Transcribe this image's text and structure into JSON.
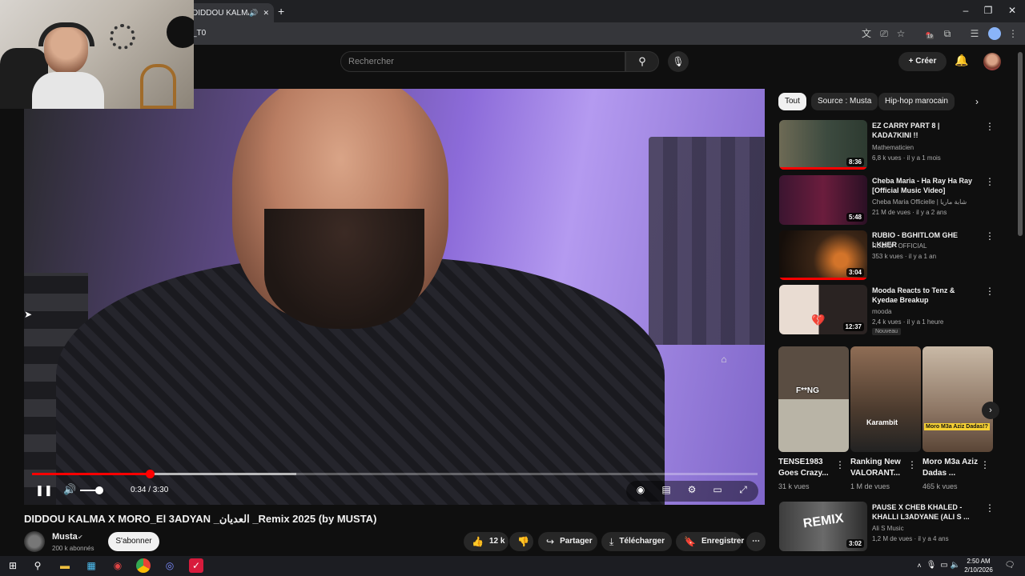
{
  "browser": {
    "tab_title": "DIDDOU KALMA X MORO_El",
    "url_fragment": "_T0",
    "extension_badge": "19"
  },
  "masthead": {
    "search_placeholder": "Rechercher",
    "create_label": "Créer"
  },
  "player": {
    "time": "0:34 / 3:30",
    "progress_fraction": 0.162
  },
  "video": {
    "title": "DIDDOU KALMA X MORO_El 3ADYAN _العديان _Remix 2025 (by MUSTA)",
    "channel": "Musta",
    "subscribers": "200 k abonnés",
    "subscribe_label": "S'abonner",
    "likes": "12 k",
    "share_label": "Partager",
    "download_label": "Télécharger",
    "save_label": "Enregistrer"
  },
  "chips": [
    "Tout",
    "Source : Musta",
    "Hip-hop marocain"
  ],
  "recommendations": [
    {
      "title": "EZ CARRY PART 8 | KADA7KINI !!",
      "channel": "Mathematicien",
      "meta": "6,8 k vues · il y a 1 mois",
      "duration": "8:36"
    },
    {
      "title": "Cheba Maria - Ha Ray Ha Ray [Official Music Video]",
      "channel": "Cheba Maria Officielle | شابة ماريا",
      "meta": "21 M de vues · il y a 2 ans",
      "duration": "5:48"
    },
    {
      "title": "RUBIO - BGHITLOM GHE LKHER",
      "channel": "RUBIO - OFFICIAL",
      "meta": "353 k vues · il y a 1 an",
      "duration": "3:04"
    },
    {
      "title": "Mooda Reacts to Tenz & Kyedae Breakup",
      "channel": "mooda",
      "meta": "2,4 k vues · il y a 1 heure",
      "duration": "12:37",
      "badge": "Nouveau"
    }
  ],
  "shorts": [
    {
      "title": "TENSE1983 Goes Crazy...",
      "views": "31 k vues",
      "overlay": "F**NG"
    },
    {
      "title": "Ranking New VALORANT...",
      "views": "1 M de vues",
      "overlay": "Karambit"
    },
    {
      "title": "Moro M3a Aziz Dadas ...",
      "views": "465 k vues",
      "overlay": "Moro M3a Aziz Dadas!?"
    }
  ],
  "last_rec": {
    "title": "PAUSE X CHEB KHALED - KHALLI L3ADYANE (ALI S ...",
    "channel": "Ali S Music",
    "meta": "1,2 M de vues · il y a 4 ans",
    "duration": "3:02",
    "thumb_text": "REMIX"
  },
  "taskbar": {
    "time": "2:50 AM",
    "date": "2/10/2026"
  }
}
